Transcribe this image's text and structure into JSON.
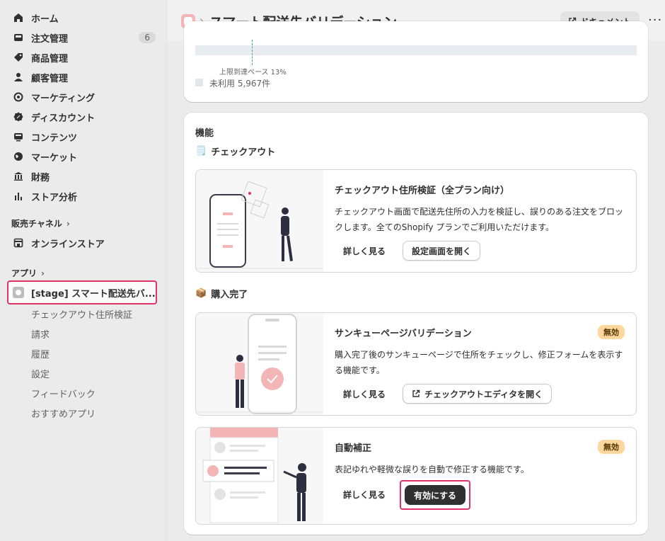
{
  "sidebar": {
    "items": [
      {
        "label": "ホーム",
        "icon": "home-icon"
      },
      {
        "label": "注文管理",
        "icon": "inbox-icon",
        "count": "6"
      },
      {
        "label": "商品管理",
        "icon": "tag-icon"
      },
      {
        "label": "顧客管理",
        "icon": "person-icon"
      },
      {
        "label": "マーケティング",
        "icon": "target-icon"
      },
      {
        "label": "ディスカウント",
        "icon": "discount-icon"
      },
      {
        "label": "コンテンツ",
        "icon": "content-icon"
      },
      {
        "label": "マーケット",
        "icon": "globe-icon"
      },
      {
        "label": "財務",
        "icon": "bank-icon"
      },
      {
        "label": "ストア分析",
        "icon": "bar-chart-icon"
      }
    ],
    "sales_channels": {
      "label": "販売チャネル",
      "items": [
        {
          "label": "オンラインストア",
          "icon": "store-icon"
        }
      ]
    },
    "apps": {
      "label": "アプリ",
      "current_app": "[stage] スマート配送先バ...",
      "sub_items": [
        "チェックアウト住所検証",
        "請求",
        "履歴",
        "設定",
        "フィードバック",
        "おすすめアプリ"
      ]
    }
  },
  "header": {
    "title": "スマート配送先バリデーション",
    "doc_button": "ドキュメント",
    "more": "···"
  },
  "usage": {
    "pace_label": "上限到達ペース 13%",
    "pace_percent": 13,
    "unused_label": "未利用 5,967件"
  },
  "features": {
    "section_title": "機能",
    "groups": [
      {
        "title": "チェックアウト",
        "emoji": "🗒️",
        "items": [
          {
            "title": "チェックアウト住所検証（全プラン向け）",
            "description": "チェックアウト画面で配送先住所の入力を検証し、誤りのある注文をブロックします。全てのShopify プランでご利用いただけます。",
            "learn_more": "詳しく見る",
            "action": "設定画面を開く"
          }
        ]
      },
      {
        "title": "購入完了",
        "emoji": "📦",
        "items": [
          {
            "title": "サンキューページバリデーション",
            "status": "無効",
            "description": "購入完了後のサンキューページで住所をチェックし、修正フォームを表示する機能です。",
            "learn_more": "詳しく見る",
            "action": "チェックアウトエディタを開く"
          },
          {
            "title": "自動補正",
            "status": "無効",
            "description": "表記ゆれや軽微な誤りを自動で修正する機能です。",
            "learn_more": "詳しく見る",
            "action": "有効にする"
          }
        ]
      }
    ]
  },
  "colors": {
    "highlight": "#e0336a",
    "status_bg": "#ffd79d",
    "pace_line": "#3aa6a0",
    "app_icon": "#f3b5b5"
  }
}
